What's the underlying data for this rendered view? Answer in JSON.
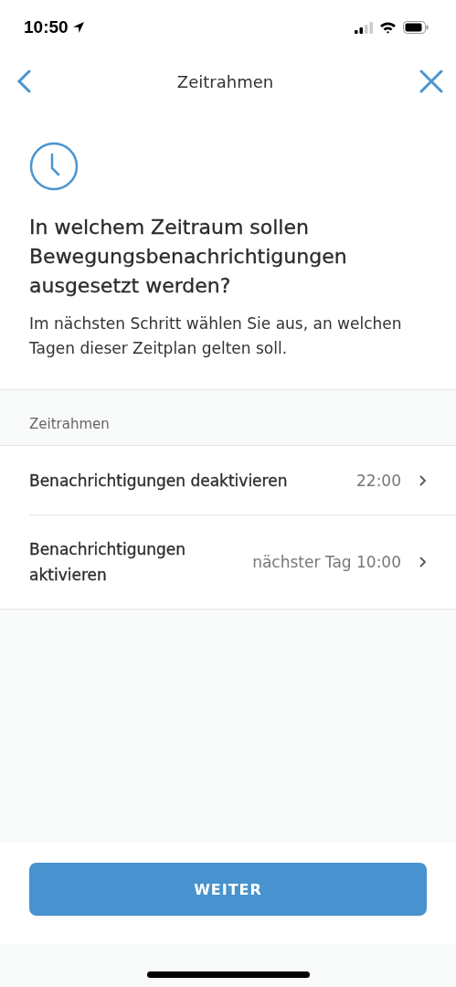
{
  "status_bar": {
    "time": "10:50"
  },
  "nav": {
    "title": "Zeitrahmen"
  },
  "heading": "In welchem Zeitraum sollen Bewegungsbenachrichtigungen ausgesetzt werden?",
  "description": "Im nächsten Schritt wählen Sie aus, an welchen Tagen dieser Zeitplan gelten soll.",
  "section": {
    "title": "Zeitrahmen",
    "rows": [
      {
        "label": "Benachrichtigungen deaktivieren",
        "value": "22:00"
      },
      {
        "label": "Benachrichtigungen aktivieren",
        "value": "nächster Tag 10:00"
      }
    ]
  },
  "button": {
    "label": "WEITER"
  }
}
